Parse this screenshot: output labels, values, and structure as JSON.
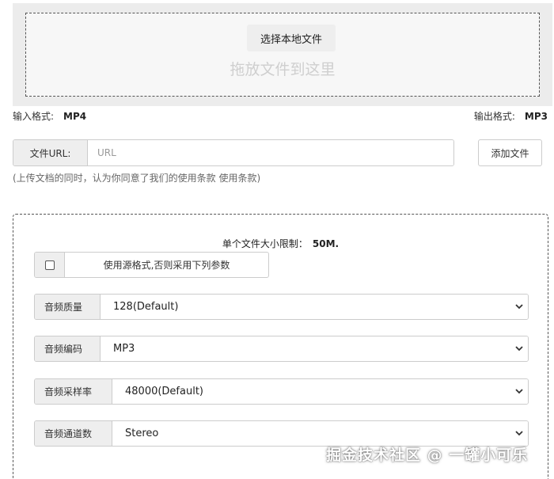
{
  "upload": {
    "choose_button": "选择本地文件",
    "drop_hint": "拖放文件到这里"
  },
  "formats": {
    "input_label": "输入格式:",
    "input_value": "MP4",
    "output_label": "输出格式:",
    "output_value": "MP3"
  },
  "url": {
    "label": "文件URL:",
    "placeholder": "URL",
    "add_button": "添加文件"
  },
  "terms": "(上传文档的同时，认为你同意了我们的使用条款 使用条款)",
  "settings": {
    "size_limit_label": "单个文件大小限制：",
    "size_limit_value": "50M.",
    "use_source_label": "使用源格式,否则采用下列参数",
    "use_source_checked": false,
    "fields": [
      {
        "label": "音频质量",
        "value": "128(Default)"
      },
      {
        "label": "音频编码",
        "value": "MP3"
      },
      {
        "label": "音频采样率",
        "value": "48000(Default)"
      },
      {
        "label": "音频通道数",
        "value": "Stereo"
      }
    ]
  },
  "watermark": "掘金技术社区 @ 一罐小可乐",
  "icons": {
    "select_arrow": "chevron-down-icon",
    "checkbox": "checkbox-icon"
  }
}
